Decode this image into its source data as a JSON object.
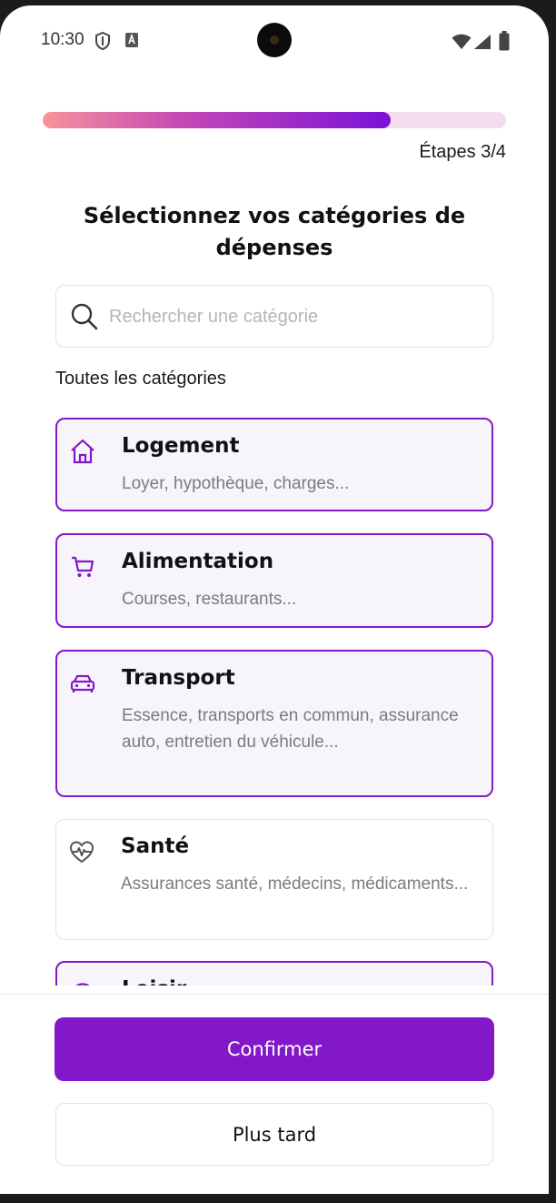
{
  "status_bar": {
    "time": "10:30",
    "icons": [
      "shield-icon",
      "keyboard-a-icon",
      "wifi-icon",
      "signal-icon",
      "battery-icon"
    ]
  },
  "progress": {
    "value": 0.75,
    "step_label": "Étapes 3/4"
  },
  "title": "Sélectionnez vos catégories de dépenses",
  "search": {
    "placeholder": "Rechercher une catégorie",
    "value": ""
  },
  "section_label": "Toutes les catégories",
  "categories": [
    {
      "name": "Logement",
      "description": "Loyer, hypothèque, charges...",
      "icon": "home-icon",
      "selected": true
    },
    {
      "name": "Alimentation",
      "description": "Courses, restaurants...",
      "icon": "cart-icon",
      "selected": true
    },
    {
      "name": "Transport",
      "description": "Essence, transports en commun, assurance auto, entretien du véhicule...",
      "icon": "car-icon",
      "selected": true
    },
    {
      "name": "Santé",
      "description": "Assurances santé, médecins, médicaments...",
      "icon": "heart-pulse-icon",
      "selected": false
    },
    {
      "name": "Loisir",
      "description": "",
      "icon": "clock-icon",
      "selected": true
    }
  ],
  "buttons": {
    "confirm": "Confirmer",
    "later": "Plus tard"
  },
  "colors": {
    "accent": "#8318c8",
    "selected_bg": "#f7f4fb",
    "progress_start": "#f7949b",
    "progress_end": "#7a12d8",
    "progress_track": "#f4dcec"
  }
}
